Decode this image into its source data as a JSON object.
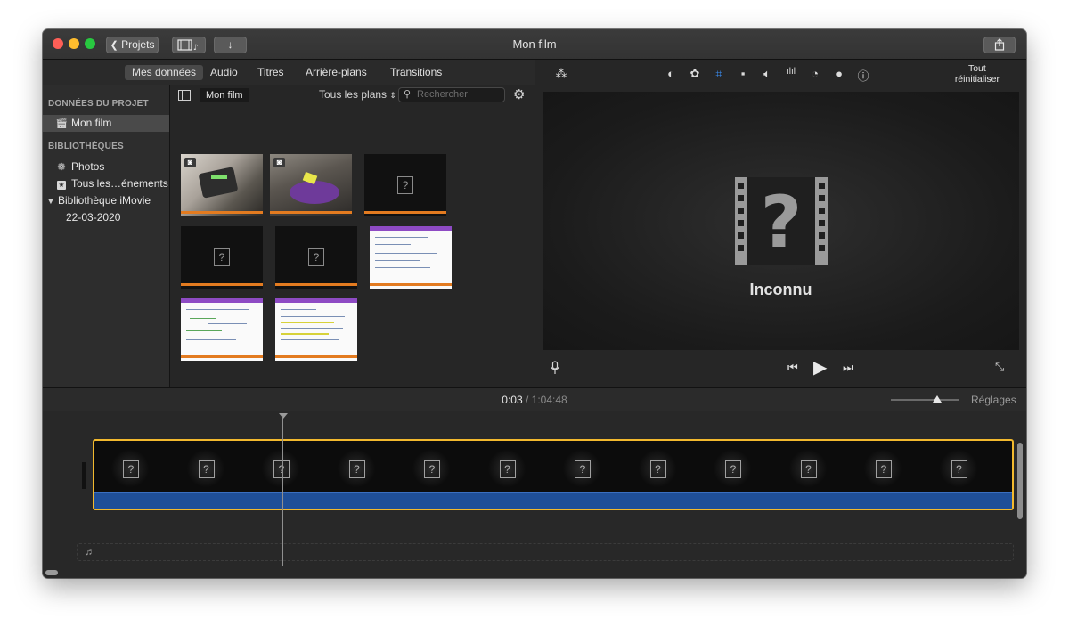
{
  "window": {
    "title": "Mon film"
  },
  "toolbar": {
    "projects_label": "Projets"
  },
  "browser_tabs": [
    "Mes données",
    "Audio",
    "Titres",
    "Arrière-plans",
    "Transitions"
  ],
  "sidebar": {
    "project_header": "DONNÉES DU PROJET",
    "project_item": "Mon film",
    "libraries_header": "BIBLIOTHÈQUES",
    "items": [
      {
        "label": "Photos",
        "icon": "flower-icon"
      },
      {
        "label": "Tous les…énements",
        "icon": "star-icon"
      },
      {
        "label": "Bibliothèque iMovie",
        "icon": "disclosure-triangle-icon"
      },
      {
        "label": "22-03-2020",
        "icon": ""
      }
    ]
  },
  "content_bar": {
    "title": "Mon film",
    "filter": "Tous les plans",
    "search_placeholder": "Rechercher"
  },
  "viewer": {
    "reset_label_line1": "Tout",
    "reset_label_line2": "réinitialiser",
    "unknown_label": "Inconnu"
  },
  "timeline": {
    "current_time": "0:03",
    "separator": "/",
    "total_time": "1:04:48",
    "settings_label": "Réglages",
    "zoom_level": 0.68
  },
  "colors": {
    "accent_selection": "#f2b92e",
    "audio_track": "#1f4f98",
    "clip_strip": "#e37b20",
    "crop_active": "#3b8ff5"
  }
}
